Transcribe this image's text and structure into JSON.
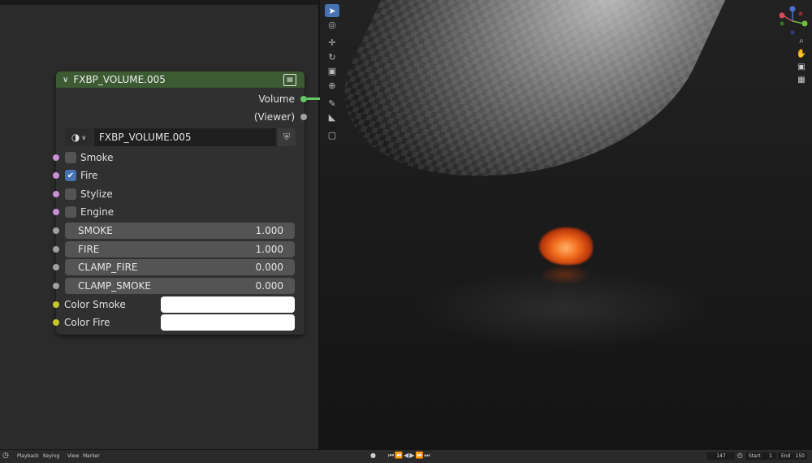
{
  "node": {
    "title": "FXBP_VOLUME.005",
    "outputs": [
      {
        "label": "Volume"
      },
      {
        "label": "(Viewer)"
      }
    ],
    "datablock": {
      "name": "FXBP_VOLUME.005"
    },
    "checkboxes": [
      {
        "label": "Smoke",
        "checked": false
      },
      {
        "label": "Fire",
        "checked": true
      },
      {
        "label": "Stylize",
        "checked": false
      },
      {
        "label": "Engine",
        "checked": false
      }
    ],
    "fields": [
      {
        "label": "SMOKE",
        "value": "1.000"
      },
      {
        "label": "FIRE",
        "value": "1.000"
      },
      {
        "label": "CLAMP_FIRE",
        "value": "0.000"
      },
      {
        "label": "CLAMP_SMOKE",
        "value": "0.000"
      }
    ],
    "colors": [
      {
        "label": "Color Smoke",
        "value": "#ffffff"
      },
      {
        "label": "Color Fire",
        "value": "#ffffff"
      }
    ],
    "header_color": "#3c5b32"
  },
  "icons": {
    "node_chevron": "chevron-down-icon",
    "node_group": "node-group-icon",
    "material": "material-sphere-icon",
    "fake_user": "shield-icon",
    "check": "checkmark-icon"
  },
  "timeline": {
    "playback": "Playback",
    "keying": "Keying",
    "view": "View",
    "marker": "Marker",
    "current_frame": "147",
    "start_label": "Start",
    "start": "1",
    "end_label": "End",
    "end": "150"
  },
  "colors": {
    "accent": "#4772b3",
    "link_volume": "#63c763",
    "socket_float": "#a1a1a1",
    "socket_bool": "#c98fd6",
    "socket_color": "#c7c729"
  }
}
